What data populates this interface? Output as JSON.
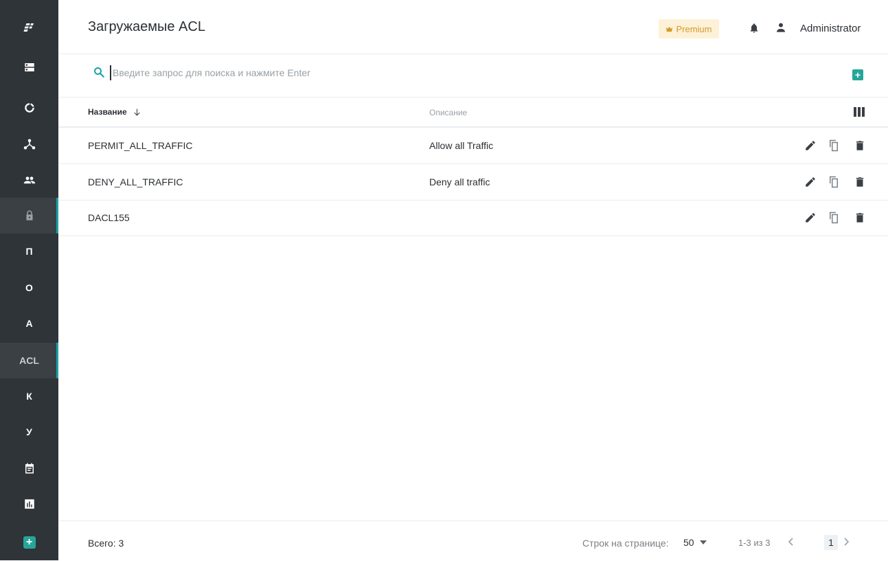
{
  "sidebar": {
    "items": [
      {
        "icon": "logo-icon"
      },
      {
        "icon": "server-icon"
      },
      {
        "icon": "ring-icon"
      },
      {
        "icon": "network-icon"
      },
      {
        "icon": "users-icon"
      },
      {
        "icon": "lock-icon",
        "active": true
      },
      {
        "label": "П"
      },
      {
        "label": "О"
      },
      {
        "label": "А"
      },
      {
        "label": "ACL",
        "active": true
      },
      {
        "label": "К"
      },
      {
        "label": "У"
      },
      {
        "icon": "calendar-icon"
      },
      {
        "icon": "chart-icon"
      },
      {
        "icon": "add-icon"
      }
    ]
  },
  "header": {
    "title": "Загружаемые ACL",
    "premium_label": "Premium",
    "user_name": "Administrator"
  },
  "search": {
    "placeholder": "Введите запрос для поиска и нажмите Enter",
    "value": ""
  },
  "table": {
    "columns": {
      "name": "Название",
      "description": "Описание"
    },
    "rows": [
      {
        "name": "PERMIT_ALL_TRAFFIC",
        "description": "Allow all Traffic"
      },
      {
        "name": "DENY_ALL_TRAFFIC",
        "description": "Deny all traffic"
      },
      {
        "name": "DACL155",
        "description": ""
      }
    ]
  },
  "footer": {
    "total": "Всего: 3",
    "rows_per_page_label": "Строк на странице:",
    "rows_per_page_value": "50",
    "range": "1-3 из 3",
    "current_page": "1"
  },
  "colors": {
    "sidebar_bg": "#2f3438",
    "accent": "#17a2a8",
    "add_green": "#26a69a",
    "premium_bg": "#fdf2d8",
    "premium_text": "#d39a2d"
  }
}
